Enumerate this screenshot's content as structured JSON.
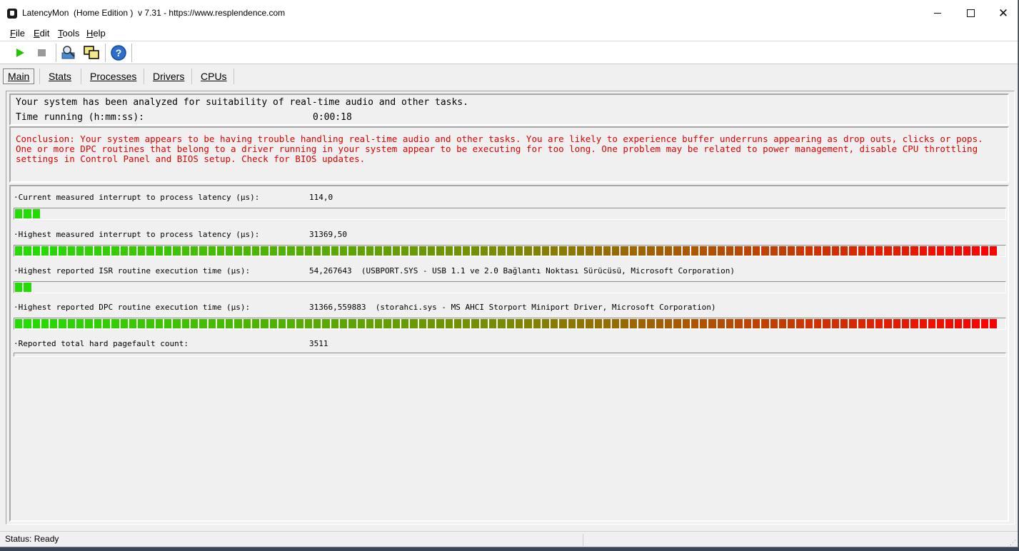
{
  "window": {
    "title": "LatencyMon  (Home Edition )  v 7.31 - https://www.resplendence.com"
  },
  "menu": [
    {
      "label_first": "F",
      "label_rest": "ile"
    },
    {
      "label_first": "E",
      "label_rest": "dit"
    },
    {
      "label_first": "T",
      "label_rest": "ools"
    },
    {
      "label_first": "H",
      "label_rest": "elp"
    }
  ],
  "toolbar": {
    "icons": [
      "play-icon",
      "stop-icon",
      "analyze-icon",
      "windows-icon",
      "help-icon"
    ]
  },
  "tabs": [
    {
      "label": "Main",
      "active": true
    },
    {
      "label": "Stats",
      "active": false
    },
    {
      "label": "Processes",
      "active": false
    },
    {
      "label": "Drivers",
      "active": false
    },
    {
      "label": "CPUs",
      "active": false
    }
  ],
  "summary": {
    "analyzed": "Your system has been analyzed for suitability of real-time audio and other tasks.",
    "time_label": "Time running (h:mm:ss):",
    "time_value": "0:00:18"
  },
  "conclusion": "Conclusion: Your system appears to be having trouble handling real-time audio and other tasks. You are likely to experience buffer underruns appearing as drop outs, clicks or pops. One or more DPC routines that belong to a driver running in your system appear to be executing for too long. One problem may be related to power management, disable CPU throttling settings in Control Panel and BIOS setup. Check for BIOS updates.",
  "metrics": {
    "current_latency": {
      "label": "·Current measured interrupt to process latency (µs):",
      "value": "114,0",
      "meter_level": 0.027
    },
    "highest_latency": {
      "label": "·Highest measured interrupt to process latency (µs):",
      "value": "31369,50",
      "meter_level": 1.0
    },
    "highest_isr": {
      "label": "·Highest reported ISR routine execution time (µs):",
      "value": "54,267643  (USBPORT.SYS - USB 1.1 ve 2.0 Bağlantı Noktası Sürücüsü, Microsoft Corporation)",
      "meter_level": 0.017
    },
    "highest_dpc": {
      "label": "·Highest reported DPC routine execution time (µs):",
      "value": "31366,559883  (storahci.sys - MS AHCI Storport Miniport Driver, Microsoft Corporation)",
      "meter_level": 1.0
    },
    "pagefaults": {
      "label": "·Reported total hard pagefault count:",
      "value": "3511"
    }
  },
  "colors": {
    "meter_start": "#22dd00",
    "meter_mid": "#7a8a00",
    "meter_end": "#ff0000",
    "conclusion_text": "#e00000"
  },
  "status": {
    "text": "Status: Ready"
  }
}
